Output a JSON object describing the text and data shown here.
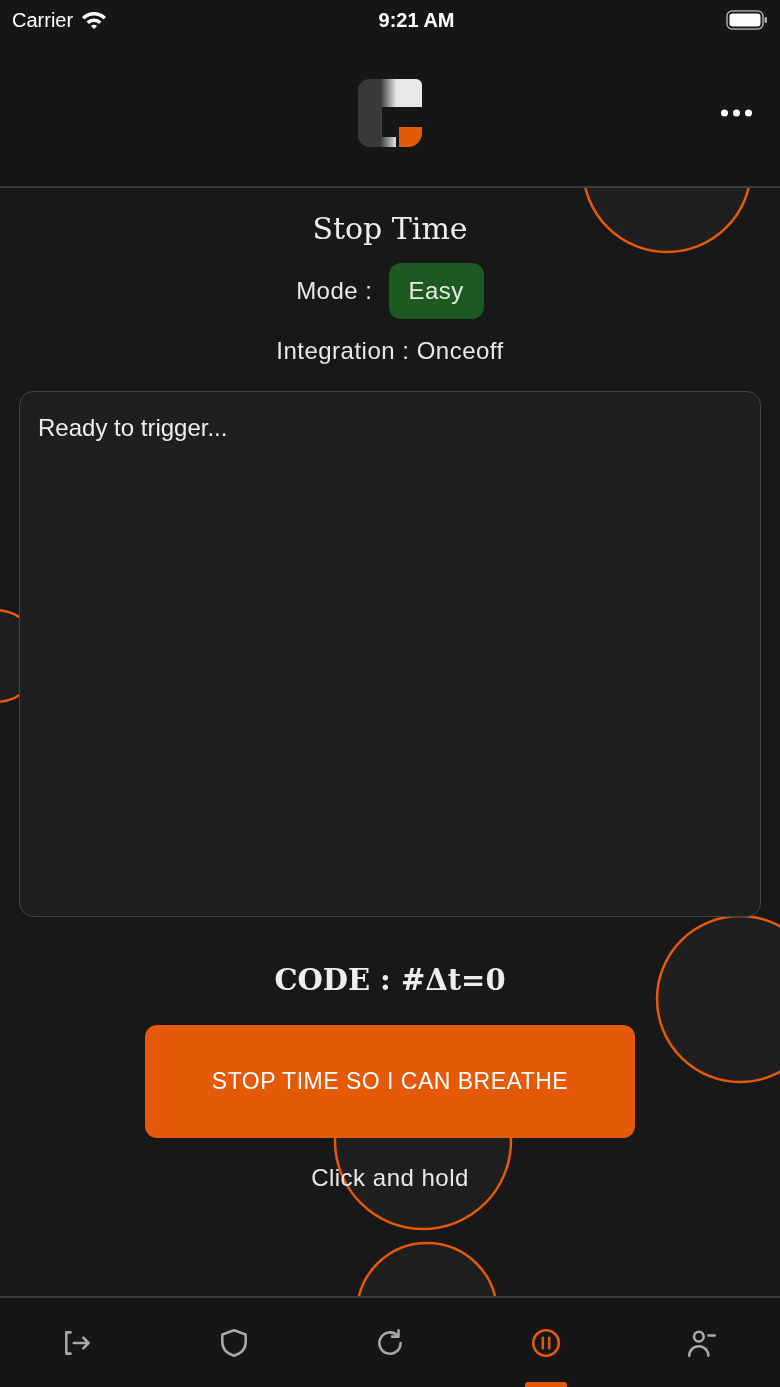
{
  "status_bar": {
    "carrier": "Carrier",
    "time": "9:21 AM"
  },
  "header": {
    "title": "Stop Time"
  },
  "mode": {
    "label": "Mode :",
    "value": "Easy"
  },
  "integration": "Integration : Onceoff",
  "log": {
    "text": "Ready to trigger..."
  },
  "code": "CODE : #Δt=0",
  "action": {
    "label": "STOP TIME SO I CAN BREATHE",
    "hint": "Click and hold"
  },
  "tabs": [
    {
      "kind": "logout",
      "selected": false
    },
    {
      "kind": "shield",
      "selected": false
    },
    {
      "kind": "refresh",
      "selected": false
    },
    {
      "kind": "pause",
      "selected": true
    },
    {
      "kind": "user",
      "selected": false
    }
  ]
}
